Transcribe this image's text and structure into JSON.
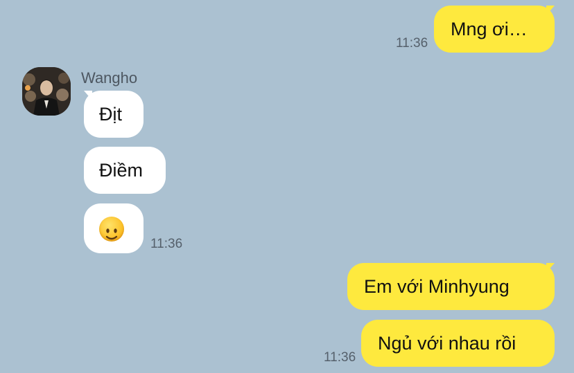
{
  "chat": {
    "messages": [
      {
        "sender": "me",
        "text": "Mng ơi…",
        "time": "11:36"
      },
      {
        "sender": "Wangho",
        "text": "Địt"
      },
      {
        "sender": "Wangho",
        "text": "Điềm"
      },
      {
        "sender": "Wangho",
        "emoji": "slightly-smiling-face-icon",
        "time": "11:36"
      },
      {
        "sender": "me",
        "text": "Em với Minhyung"
      },
      {
        "sender": "me",
        "text": "Ngủ với nhau rồi",
        "time": "11:36"
      }
    ]
  },
  "participant": {
    "name": "Wangho"
  },
  "colors": {
    "background": "#abc1d1",
    "outgoing_bubble": "#fee93e",
    "incoming_bubble": "#ffffff",
    "timestamp": "#55606b"
  }
}
